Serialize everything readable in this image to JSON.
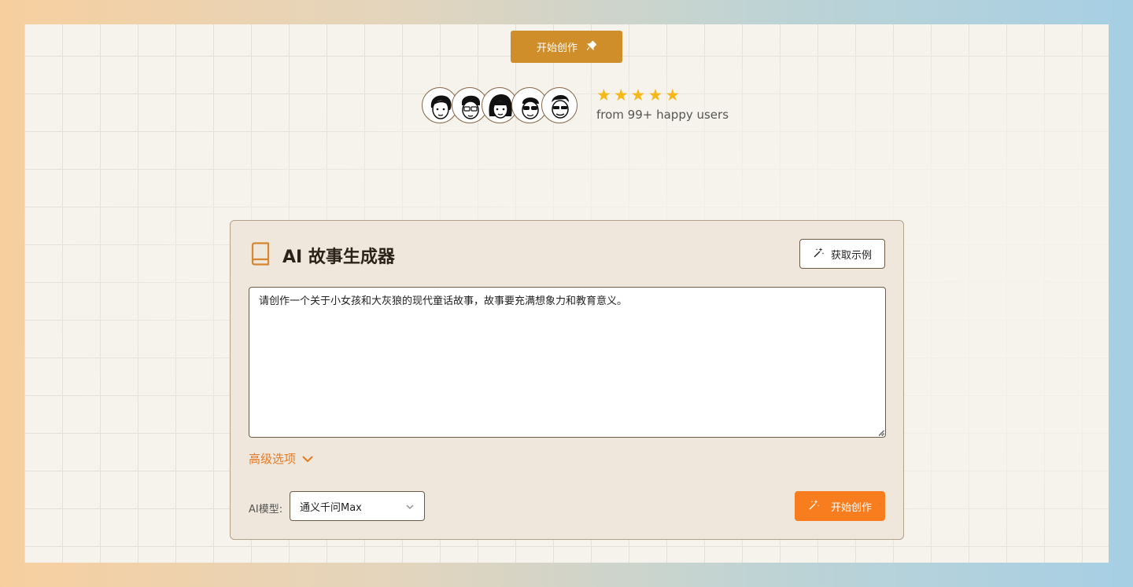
{
  "header": {
    "cta_label": "开始创作",
    "cta_icon": "pin-icon"
  },
  "social_proof": {
    "avatars": [
      "avatar-1",
      "avatar-2",
      "avatar-3",
      "avatar-4",
      "avatar-5"
    ],
    "rating_stars": 5,
    "caption": "from 99+ happy users"
  },
  "card": {
    "title": "AI 故事生成器",
    "title_icon": "book-icon",
    "example_button": "获取示例",
    "prompt_value": "请创作一个关于小女孩和大灰狼的现代童话故事，故事要充满想象力和教育意义。",
    "advanced_label": "高级选项",
    "model_label": "AI模型:",
    "model_selected": "通义千问Max",
    "generate_button": "开始创作"
  },
  "colors": {
    "accent_orange": "#f77d1e",
    "cta_gold": "#cf8e29",
    "star_yellow": "#f5b81a"
  }
}
